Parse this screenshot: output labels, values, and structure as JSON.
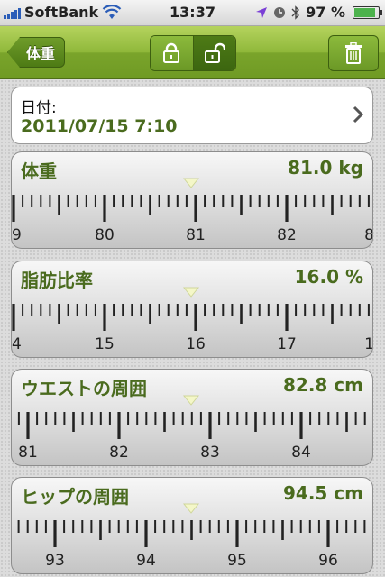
{
  "status_bar": {
    "carrier": "SoftBank",
    "time": "13:37",
    "battery_percent": "97 %",
    "battery_level": 0.97,
    "icons": [
      "signal-icon",
      "wifi-icon",
      "location-icon",
      "alarm-icon",
      "bluetooth-icon",
      "battery-icon"
    ]
  },
  "nav": {
    "back_label": "体重",
    "lock_icons": [
      "lock-closed-icon",
      "lock-open-icon"
    ],
    "trash_icon": "trash-icon"
  },
  "date": {
    "label": "日付:",
    "value": "2011/07/15 7:10"
  },
  "scales": [
    {
      "title": "体重",
      "value": "81.0 kg",
      "labels": [
        "9",
        "80",
        "81",
        "82",
        "8"
      ]
    },
    {
      "title": "脂肪比率",
      "value": "16.0 %",
      "labels": [
        "4",
        "15",
        "16",
        "17",
        "1"
      ]
    },
    {
      "title": "ウエストの周囲",
      "value": "82.8 cm",
      "labels": [
        "81",
        "82",
        "83",
        "84"
      ]
    },
    {
      "title": "ヒップの周囲",
      "value": "94.5 cm",
      "labels": [
        "93",
        "94",
        "95",
        "96"
      ]
    }
  ],
  "colors": {
    "nav_green": "#8fb83a",
    "text_green": "#4a6b1e"
  }
}
